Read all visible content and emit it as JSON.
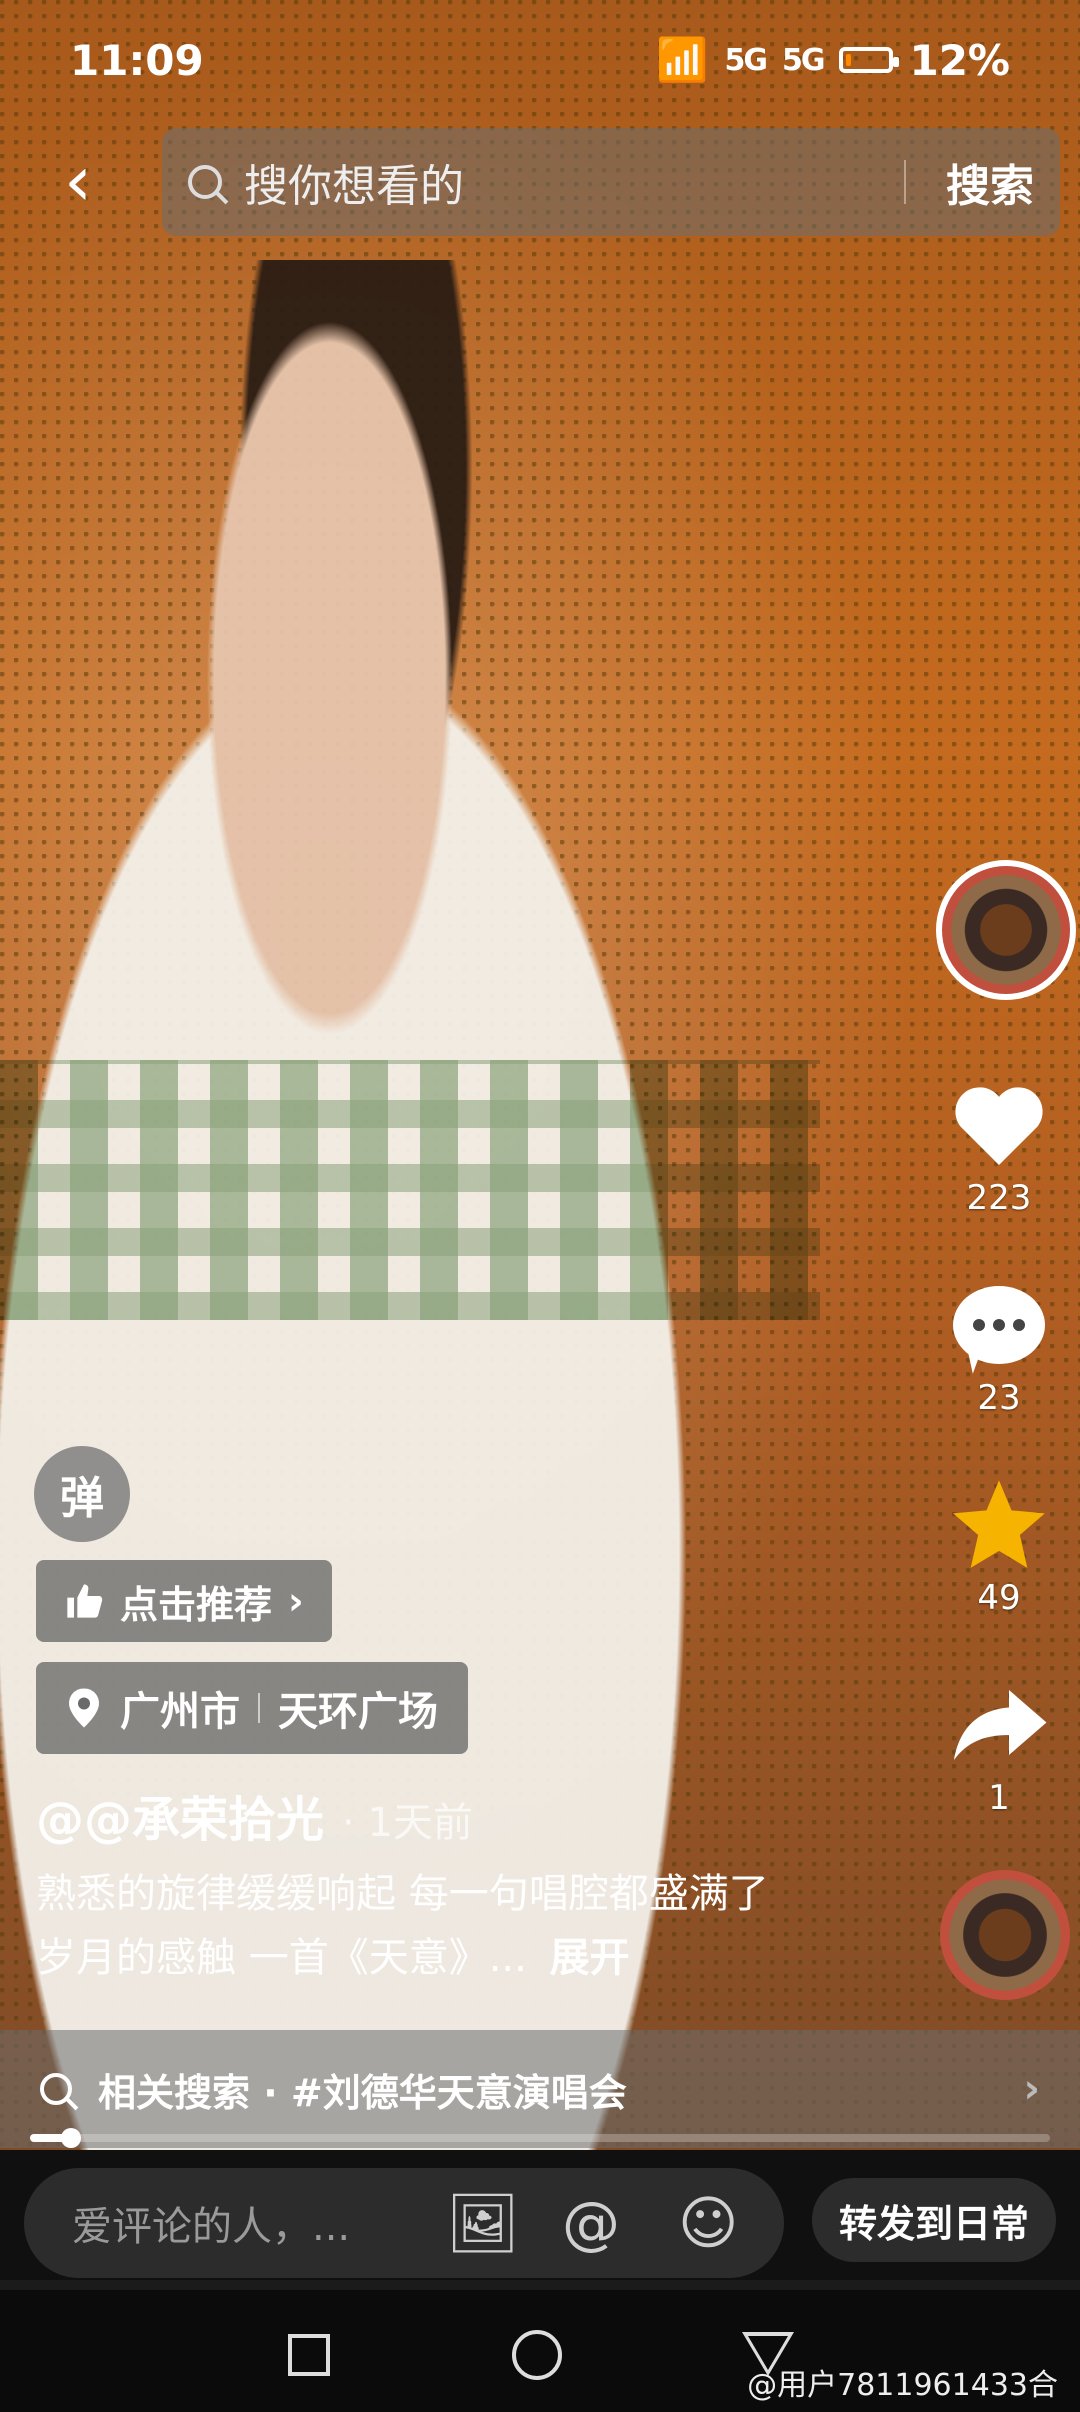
{
  "status_bar": {
    "time": "11:09",
    "signal_1": "5G",
    "signal_2": "5G",
    "battery": "12%",
    "battery_level": 0.12
  },
  "search": {
    "placeholder": "搜你想看的",
    "button": "搜索"
  },
  "rail": {
    "likes": "223",
    "comments": "23",
    "favorites": "49",
    "shares": "1"
  },
  "danmu": "弹",
  "recommend": {
    "label": "点击推荐",
    "chevron": "›"
  },
  "location": {
    "city": "广州市",
    "place": "天环广场"
  },
  "post": {
    "author": "@@承荣拾光",
    "time": "· 1天前",
    "description": "熟悉的旋律缓缓响起 每一句唱腔都盛满了岁月的感触 一首《天意》...",
    "expand": "展开"
  },
  "related": {
    "label": "相关搜索 · #刘德华天意演唱会"
  },
  "progress": 0.04,
  "comment_bar": {
    "placeholder": "爱评论的人，...",
    "forward": "转发到日常"
  },
  "watermark": "@用户7811961433合",
  "colors": {
    "star": "#f6b400",
    "battery": "#ff8a00"
  }
}
